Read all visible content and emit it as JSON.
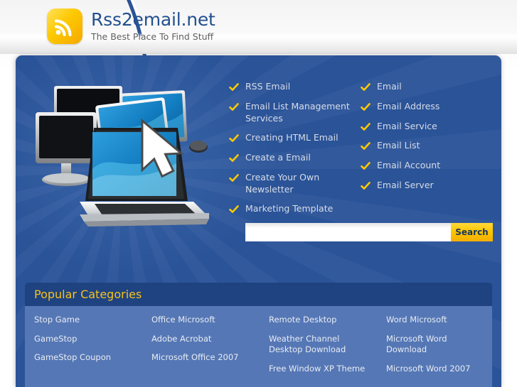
{
  "header": {
    "logo_icon": "rss-wave-icon",
    "site_title": "Rss2email.net",
    "tagline": "The Best Place To Find Stuff",
    "logo_color": "#fdc800",
    "title_color": "#23508f"
  },
  "theme": {
    "panel_blue": "#2a5398",
    "cats_header_blue": "#1f4380",
    "cats_body_blue": "#5577b5",
    "accent_gold": "#fdc800",
    "link_text": "#d7dce7"
  },
  "hero": {
    "alt": "desktop monitors and laptop with large mouse cursor illustration",
    "icon": "computers-cursor-illustration"
  },
  "links": {
    "columns": [
      {
        "items": [
          {
            "label": "RSS Email"
          },
          {
            "label": "Email List Management Services"
          },
          {
            "label": "Creating HTML Email"
          },
          {
            "label": "Create a Email"
          },
          {
            "label": "Create Your Own Newsletter"
          },
          {
            "label": "Marketing Template"
          }
        ]
      },
      {
        "items": [
          {
            "label": "Email"
          },
          {
            "label": "Email Address"
          },
          {
            "label": "Email Service"
          },
          {
            "label": "Email List"
          },
          {
            "label": "Email Account"
          },
          {
            "label": "Email Server"
          }
        ]
      }
    ]
  },
  "search": {
    "value": "",
    "placeholder": "",
    "button_label": "Search"
  },
  "categories": {
    "title": "Popular Categories",
    "columns": [
      {
        "items": [
          "Stop Game",
          "GameStop",
          "GameStop Coupon"
        ]
      },
      {
        "items": [
          "Office Microsoft",
          "Adobe Acrobat",
          "Microsoft Office 2007"
        ]
      },
      {
        "items": [
          "Remote Desktop",
          "Weather Channel Desktop Download",
          "Free Window XP Theme"
        ]
      },
      {
        "items": [
          "Word Microsoft",
          "Microsoft Word Download",
          "Microsoft Word 2007"
        ]
      }
    ]
  }
}
